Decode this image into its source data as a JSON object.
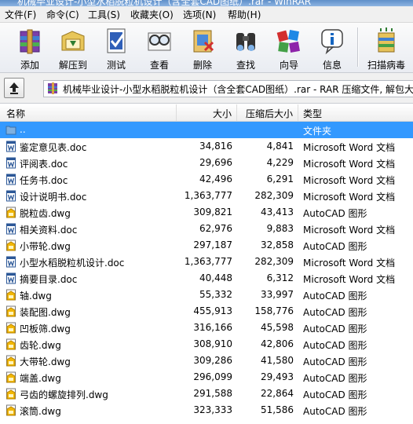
{
  "window": {
    "title": "机械毕业设计-小型水稻脱粒机设计（含全套CAD图纸）.rar - WinRAR"
  },
  "menu": [
    {
      "label": "文件(F)"
    },
    {
      "label": "命令(C)"
    },
    {
      "label": "工具(S)"
    },
    {
      "label": "收藏夹(O)"
    },
    {
      "label": "选项(N)"
    },
    {
      "label": "帮助(H)"
    }
  ],
  "toolbar": [
    {
      "label": "添加",
      "icon": "add-archive-icon"
    },
    {
      "label": "解压到",
      "icon": "extract-to-icon"
    },
    {
      "label": "测试",
      "icon": "test-icon"
    },
    {
      "label": "查看",
      "icon": "view-icon"
    },
    {
      "label": "删除",
      "icon": "delete-icon"
    },
    {
      "label": "查找",
      "icon": "find-icon"
    },
    {
      "label": "向导",
      "icon": "wizard-icon"
    },
    {
      "label": "信息",
      "icon": "info-icon"
    },
    {
      "label": "扫描病毒",
      "icon": "virus-scan-icon"
    }
  ],
  "address": {
    "path": "机械毕业设计-小型水稻脱粒机设计（含全套CAD图纸）.rar - RAR 压缩文件, 解包大小"
  },
  "columns": {
    "name": "名称",
    "size": "大小",
    "packed": "压缩后大小",
    "type": "类型"
  },
  "files": [
    {
      "name": "..",
      "size": "",
      "packed": "",
      "type": "文件夹",
      "icon": "folder-icon"
    },
    {
      "name": "鉴定意见表.doc",
      "size": "34,816",
      "packed": "4,841",
      "type": "Microsoft Word 文档",
      "icon": "word-doc-icon"
    },
    {
      "name": "评阅表.doc",
      "size": "29,696",
      "packed": "4,229",
      "type": "Microsoft Word 文档",
      "icon": "word-doc-icon"
    },
    {
      "name": "任务书.doc",
      "size": "42,496",
      "packed": "6,291",
      "type": "Microsoft Word 文档",
      "icon": "word-doc-icon"
    },
    {
      "name": "设计说明书.doc",
      "size": "1,363,777",
      "packed": "282,309",
      "type": "Microsoft Word 文档",
      "icon": "word-doc-icon"
    },
    {
      "name": "脱粒齿.dwg",
      "size": "309,821",
      "packed": "43,413",
      "type": "AutoCAD 图形",
      "icon": "dwg-file-icon"
    },
    {
      "name": "相关资料.doc",
      "size": "62,976",
      "packed": "9,883",
      "type": "Microsoft Word 文档",
      "icon": "word-doc-icon"
    },
    {
      "name": "小带轮.dwg",
      "size": "297,187",
      "packed": "32,858",
      "type": "AutoCAD 图形",
      "icon": "dwg-file-icon"
    },
    {
      "name": "小型水稻脱粒机设计.doc",
      "size": "1,363,777",
      "packed": "282,309",
      "type": "Microsoft Word 文档",
      "icon": "word-doc-icon"
    },
    {
      "name": "摘要目录.doc",
      "size": "40,448",
      "packed": "6,312",
      "type": "Microsoft Word 文档",
      "icon": "word-doc-icon"
    },
    {
      "name": "轴.dwg",
      "size": "55,332",
      "packed": "33,997",
      "type": "AutoCAD 图形",
      "icon": "dwg-file-icon"
    },
    {
      "name": "装配图.dwg",
      "size": "455,913",
      "packed": "158,776",
      "type": "AutoCAD 图形",
      "icon": "dwg-file-icon"
    },
    {
      "name": "凹板筛.dwg",
      "size": "316,166",
      "packed": "45,598",
      "type": "AutoCAD 图形",
      "icon": "dwg-file-icon"
    },
    {
      "name": "齿轮.dwg",
      "size": "308,910",
      "packed": "42,806",
      "type": "AutoCAD 图形",
      "icon": "dwg-file-icon"
    },
    {
      "name": "大带轮.dwg",
      "size": "309,286",
      "packed": "41,580",
      "type": "AutoCAD 图形",
      "icon": "dwg-file-icon"
    },
    {
      "name": "端盖.dwg",
      "size": "296,099",
      "packed": "29,493",
      "type": "AutoCAD 图形",
      "icon": "dwg-file-icon"
    },
    {
      "name": "弓齿的螺旋排列.dwg",
      "size": "291,588",
      "packed": "22,864",
      "type": "AutoCAD 图形",
      "icon": "dwg-file-icon"
    },
    {
      "name": "滚筒.dwg",
      "size": "323,333",
      "packed": "51,586",
      "type": "AutoCAD 图形",
      "icon": "dwg-file-icon"
    }
  ],
  "colors": {
    "selection": "#3399ff",
    "dwg": "#f2b705",
    "word": "#2b5797"
  }
}
